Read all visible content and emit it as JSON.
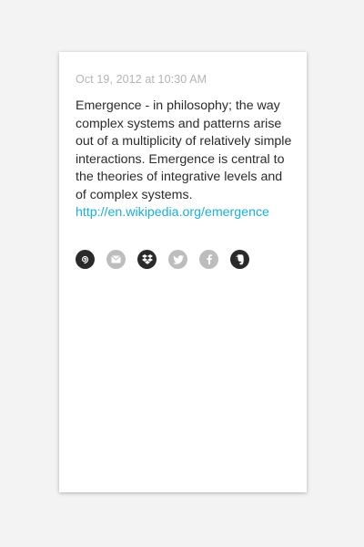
{
  "note": {
    "timestamp": "Oct 19, 2012 at 10:30 AM",
    "body": "Emergence - in philosophy; the way complex systems and patterns arise out of a multiplicity of relatively simple interactions. Emergence is central to the theories of integrative levels and of complex systems.",
    "link": "http://en.wikipedia.org/emergence"
  },
  "share": {
    "buttons": [
      {
        "icon": "spiral-icon",
        "color": "#2a2a2a"
      },
      {
        "icon": "mail-icon",
        "color": "#bdbdbd"
      },
      {
        "icon": "dropbox-icon",
        "color": "#2a2a2a"
      },
      {
        "icon": "twitter-icon",
        "color": "#bdbdbd"
      },
      {
        "icon": "facebook-icon",
        "color": "#bdbdbd"
      },
      {
        "icon": "evernote-icon",
        "color": "#2a2a2a"
      }
    ]
  },
  "colors": {
    "background": "#f3f3f3",
    "card": "#ffffff",
    "link": "#1ab0d8",
    "timestamp": "#b4b4b4",
    "text": "#2b2b2b"
  }
}
